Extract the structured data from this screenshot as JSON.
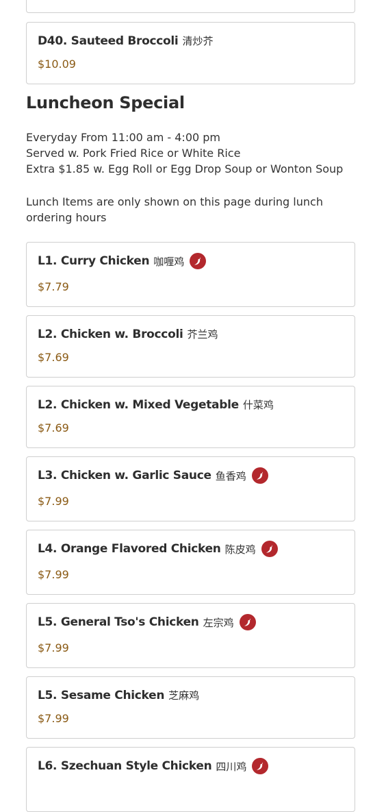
{
  "prev_item": {
    "name": "D40. Sauteed Broccoli",
    "cjk": "清炒芥",
    "price": "$10.09"
  },
  "section": {
    "title": "Luncheon Special",
    "info": [
      "Everyday From 11:00 am - 4:00 pm",
      "Served w. Pork Fried Rice or White Rice",
      "Extra $1.85 w. Egg Roll or Egg Drop Soup or Wonton Soup"
    ],
    "notice": "Lunch Items are only shown on this page during lunch ordering hours"
  },
  "items": [
    {
      "name": "L1. Curry Chicken",
      "cjk": "咖喱鸡",
      "price": "$7.79",
      "spicy": true,
      "spicy_icon": "chili-pepper-icon"
    },
    {
      "name": "L2. Chicken w. Broccoli",
      "cjk": "芥兰鸡",
      "price": "$7.69",
      "spicy": false
    },
    {
      "name": "L2. Chicken w. Mixed Vegetable",
      "cjk": "什菜鸡",
      "price": "$7.69",
      "spicy": false
    },
    {
      "name": "L3. Chicken w. Garlic Sauce",
      "cjk": "鱼香鸡",
      "price": "$7.99",
      "spicy": true,
      "spicy_icon": "chili-pepper-icon"
    },
    {
      "name": "L4. Orange Flavored Chicken",
      "cjk": "陈皮鸡",
      "price": "$7.99",
      "spicy": true,
      "spicy_icon": "chili-pepper-icon"
    },
    {
      "name": "L5. General Tso's Chicken",
      "cjk": "左宗鸡",
      "price": "$7.99",
      "spicy": true,
      "spicy_icon": "chili-pepper-icon"
    },
    {
      "name": "L5. Sesame Chicken",
      "cjk": "芝麻鸡",
      "price": "$7.99",
      "spicy": false
    },
    {
      "name": "L6. Szechuan Style Chicken",
      "cjk": "四川鸡",
      "spicy": true,
      "spicy_icon": "chili-pepper-icon"
    }
  ],
  "colors": {
    "price": "#8a5a14",
    "spicy_badge": "#b3282d",
    "card_border": "#cfcfcf"
  }
}
